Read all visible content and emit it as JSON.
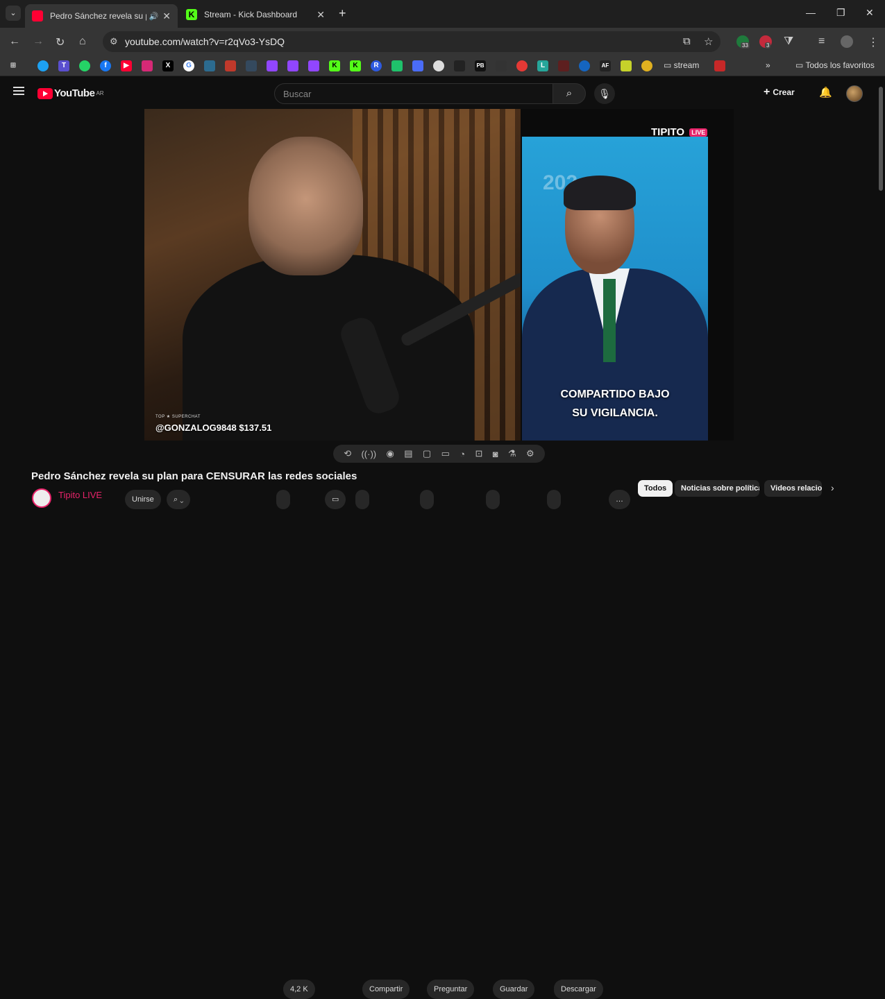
{
  "browser": {
    "tabs": [
      {
        "title": "Pedro Sánchez revela su plan para CENSURAR las redes sociales",
        "favicon": "youtube-icon",
        "color": "#ff0033",
        "active": true,
        "audio": true
      },
      {
        "title": "Stream - Kick Dashboard",
        "favicon": "kick-icon",
        "color": "#53fc18",
        "active": false
      }
    ],
    "url": "youtube.com/watch?v=r2qVo3-YsDQ",
    "extension_badges": [
      "33",
      "3"
    ],
    "bookmarks_folder": "stream",
    "all_bookmarks_label": "Todos los favoritos"
  },
  "youtube": {
    "logo_text": "YouTube",
    "country_code": "AR",
    "search_placeholder": "Buscar",
    "create_label": "Crear"
  },
  "video": {
    "superchat_tag": "TOP ★ SUPERCHAT",
    "superchat_text": "@GONZALOG9848 $137.51",
    "channel_overlay": "TIPITO",
    "live_tag": "LIVE",
    "caption_line1": "COMPARTIDO BAJO",
    "caption_line2": "SU VIGILANCIA.",
    "title": "Pedro Sánchez revela su plan para CENSURAR las redes sociales",
    "channel_name": "Tipito LIVE"
  },
  "actions": [
    "Unirse",
    "4,2 K",
    "Compartir",
    "Preguntar",
    "Guardar",
    "Descargar"
  ],
  "chips": [
    "Todos",
    "Noticias sobre política",
    "Videos relacionados"
  ],
  "colors": {
    "accent": "#ff0033",
    "kick": "#53fc18",
    "tipito": "#e8246a"
  }
}
